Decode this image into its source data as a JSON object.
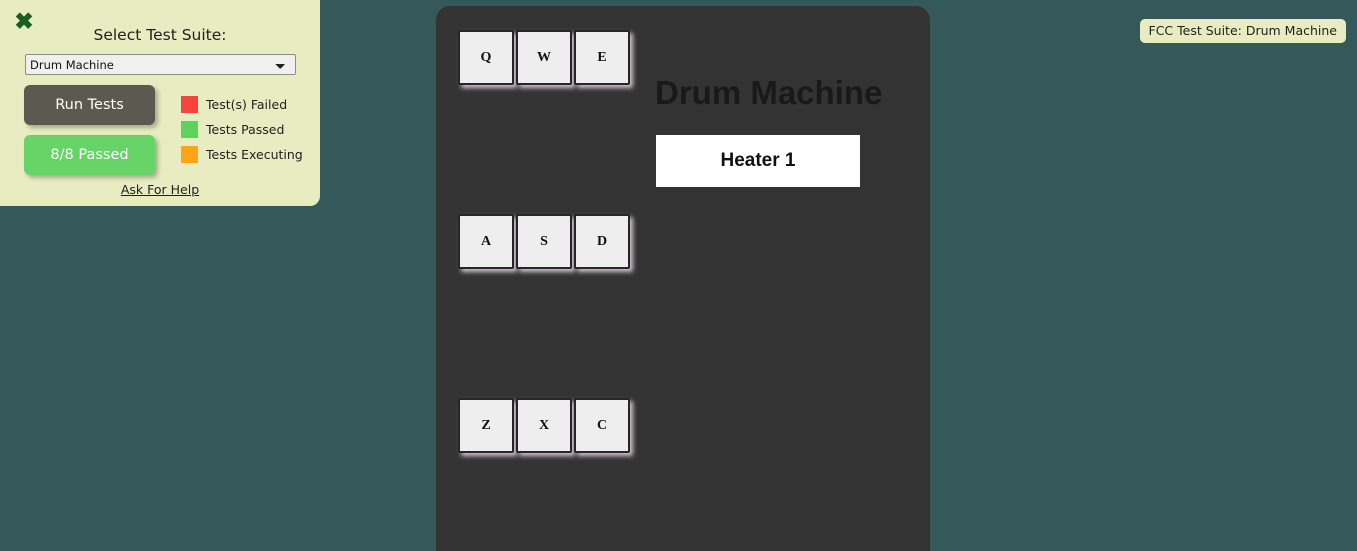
{
  "colors": {
    "background": "#35595a",
    "panel_bg": "#e7edc1",
    "failed": "#f4453c",
    "passed": "#5fd15f",
    "executing": "#ffa419",
    "run_button": "#5a5a50",
    "status_button": "#66d466",
    "machine_bg": "#333333",
    "pad_bg": "#eeeeee"
  },
  "fcc_panel": {
    "close_icon": "✖",
    "title": "Select Test Suite:",
    "select": {
      "selected": "Drum Machine",
      "options": [
        "Drum Machine"
      ]
    },
    "run_tests_label": "Run Tests",
    "status_label": "8/8 Passed",
    "legend": [
      {
        "color": "#f4453c",
        "label": "Test(s) Failed"
      },
      {
        "color": "#5fd15f",
        "label": "Tests Passed"
      },
      {
        "color": "#ffa419",
        "label": "Tests Executing"
      }
    ],
    "help_link_label": "Ask For Help"
  },
  "badge": {
    "text": "FCC Test Suite: Drum Machine"
  },
  "drum_machine": {
    "title": "Drum Machine",
    "display_text": "Heater 1",
    "pad_rows": [
      [
        "Q",
        "W",
        "E"
      ],
      [
        "A",
        "S",
        "D"
      ],
      [
        "Z",
        "X",
        "C"
      ]
    ]
  }
}
